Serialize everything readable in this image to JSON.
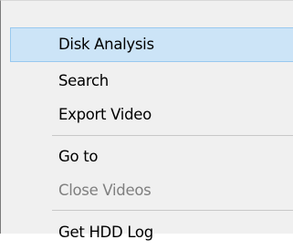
{
  "context_menu": {
    "items": [
      {
        "label": "Disk Analysis",
        "state": "highlighted"
      },
      {
        "label": "Search",
        "state": "normal"
      },
      {
        "label": "Export Video",
        "state": "normal"
      },
      {
        "label": "Go to",
        "state": "normal"
      },
      {
        "label": "Close Videos",
        "state": "disabled"
      },
      {
        "label": "Get HDD Log",
        "state": "normal"
      }
    ],
    "colors": {
      "background": "#f0f0f0",
      "highlight_fill": "#cce4f7",
      "highlight_border": "#99c9ef",
      "disabled_text": "#7f7f7f",
      "separator": "#c8c8c8"
    }
  }
}
